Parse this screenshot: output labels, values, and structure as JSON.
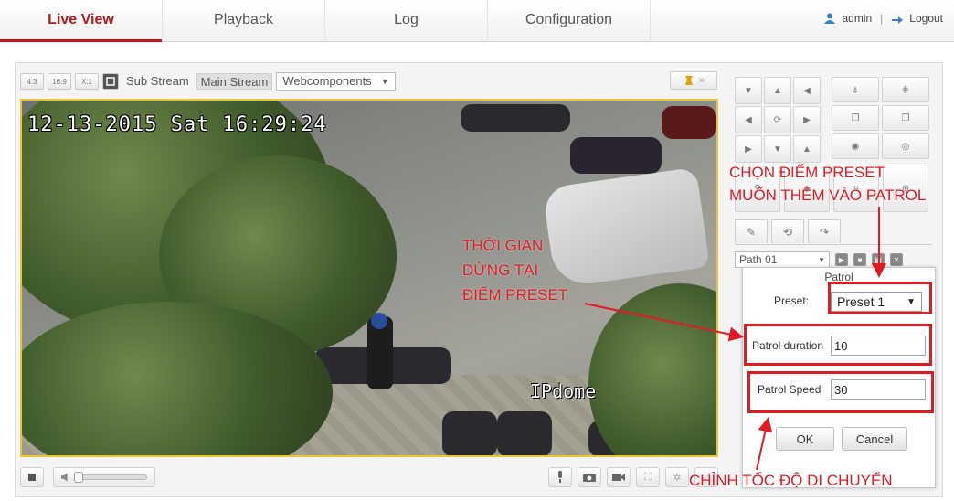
{
  "nav": {
    "tabs": [
      {
        "label": "Live View"
      },
      {
        "label": "Playback"
      },
      {
        "label": "Log"
      },
      {
        "label": "Configuration"
      }
    ],
    "user": "admin",
    "separator": "|",
    "logout": "Logout",
    "accent_color": "#c01818"
  },
  "video_toolbar": {
    "ratio_buttons": [
      "4:3",
      "16:9",
      "X:1"
    ],
    "sub_stream": "Sub Stream",
    "main_stream": "Main Stream",
    "plugin_select": "Webcomponents",
    "more": "»"
  },
  "video": {
    "osd_timestamp": "12-13-2015 Sat 16:29:24",
    "osd_camera_name": "IPdome"
  },
  "patrol": {
    "path_select": "Path 01",
    "dialog_title": "Patrol",
    "preset_label": "Preset:",
    "preset_value": "Preset 1",
    "duration_label": "Patrol duration",
    "duration_value": "10",
    "speed_label": "Patrol Speed",
    "speed_value": "30",
    "ok": "OK",
    "cancel": "Cancel"
  },
  "annotations": {
    "color": "#e21b23",
    "choose_preset_line1": "CHỌN ĐIỂM PRESET",
    "choose_preset_line2": "MUỐN THÊM VÀO PATROL",
    "dwell_line1": "THỜI GIAN",
    "dwell_line2": "DỪNG TẠI",
    "dwell_line3": "ĐIỂM PRESET",
    "speed_note": "CHỈNH TỐC ĐỘ DI CHUYỂN"
  }
}
